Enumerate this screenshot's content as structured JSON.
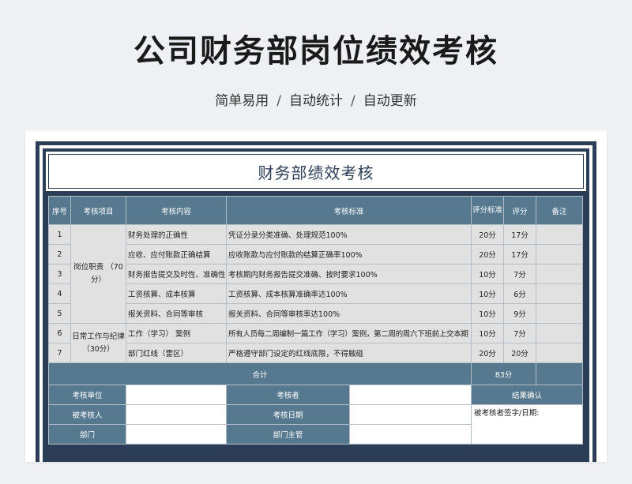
{
  "page": {
    "title": "公司财务部岗位绩效考核",
    "subtitle": [
      "简单易用",
      "自动统计",
      "自动更新"
    ],
    "subtitle_sep": "/"
  },
  "sheet": {
    "title": "财务部绩效考核",
    "headers": {
      "no": "序号",
      "item": "考核项目",
      "content": "考核内容",
      "standard": "考核标准",
      "full_score": "评分标准",
      "score": "评分",
      "remark": "备注"
    },
    "groups": [
      {
        "name": "岗位职责\n（70分）"
      },
      {
        "name": "日常工作与纪律\n（30分）"
      }
    ],
    "rows": [
      {
        "no": "1",
        "content": "财务处理的正确性",
        "standard": "凭证分录分类准确、处理规范100%",
        "full": "20分",
        "score": "17分",
        "remark": ""
      },
      {
        "no": "2",
        "content": "应收、应付账款正确结算",
        "standard": "应收账款与应付账款的结算正确率100%",
        "full": "20分",
        "score": "17分",
        "remark": ""
      },
      {
        "no": "3",
        "content": "财务报告提交及时性、准确性",
        "standard": "考核期内财务报告提交准确、按时要求100%",
        "full": "10分",
        "score": "7分",
        "remark": ""
      },
      {
        "no": "4",
        "content": "工资核算、成本核算",
        "standard": "工资核算、成本核算准确率达100%",
        "full": "10分",
        "score": "6分",
        "remark": ""
      },
      {
        "no": "5",
        "content": "报关资料、合同等审核",
        "standard": "报关资料、合同等审核率达100%",
        "full": "10分",
        "score": "9分",
        "remark": ""
      },
      {
        "no": "6",
        "content": "工作（学习） 案例",
        "standard": "所有人员每二周编制一篇工作（学习）案例，第二周的周六下班前上交本期",
        "full": "10分",
        "score": "7分",
        "remark": ""
      },
      {
        "no": "7",
        "content": "部门红线（雷区）",
        "standard": "严格遵守部门设定的红线底限，不得触碰",
        "full": "20分",
        "score": "20分",
        "remark": ""
      }
    ],
    "total": {
      "label": "合计",
      "value": "83分"
    },
    "footer": {
      "unit_label": "考核单位",
      "assessor_label": "考核者",
      "result_label": "结果确认",
      "assessee_label": "被考核人",
      "date_label": "考核日期",
      "sign_label": "被考核者签字/日期:",
      "dept_label": "部门",
      "dept_head_label": "部门主管"
    }
  }
}
